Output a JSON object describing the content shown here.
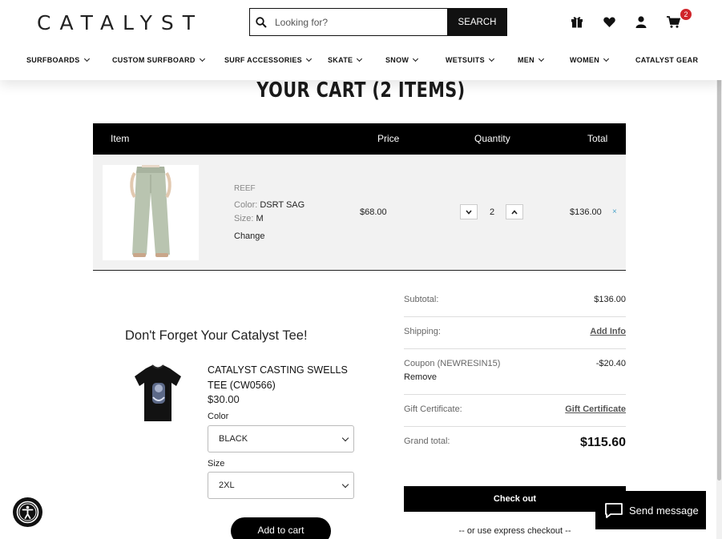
{
  "header": {
    "logo": "CATALYST",
    "search": {
      "placeholder": "Looking for?",
      "button_label": "SEARCH"
    },
    "icons": [
      "gift-icon",
      "heart-icon",
      "user-icon",
      "cart-icon"
    ],
    "cart_count": "2"
  },
  "nav": {
    "items": [
      {
        "label": "SURFBOARDS",
        "has_dropdown": true
      },
      {
        "label": "CUSTOM SURFBOARD",
        "has_dropdown": true
      },
      {
        "label": "SURF ACCESSORIES",
        "has_dropdown": true
      },
      {
        "label": "SKATE",
        "has_dropdown": true
      },
      {
        "label": "SNOW",
        "has_dropdown": true
      },
      {
        "label": "WETSUITS",
        "has_dropdown": true
      },
      {
        "label": "MEN",
        "has_dropdown": true
      },
      {
        "label": "WOMEN",
        "has_dropdown": true
      },
      {
        "label": "CATALYST GEAR",
        "has_dropdown": false
      }
    ]
  },
  "cart": {
    "title": "YOUR CART (2 ITEMS)",
    "columns": {
      "item": "Item",
      "price": "Price",
      "quantity": "Quantity",
      "total": "Total"
    },
    "items": [
      {
        "brand": "REEF",
        "color_label": "Color:",
        "color": "DSRT SAG",
        "size_label": "Size:",
        "size": "M",
        "change_label": "Change",
        "price": "$68.00",
        "quantity": "2",
        "total": "$136.00",
        "remove": "×"
      }
    ]
  },
  "upsell": {
    "title": "Don't Forget Your Catalyst Tee!",
    "product_name": "CATALYST CASTING SWELLS TEE (CW0566)",
    "price": "$30.00",
    "color_label": "Color",
    "color_value": "BLACK",
    "size_label": "Size",
    "size_value": "2XL",
    "add_button": "Add to cart"
  },
  "summary": {
    "subtotal_label": "Subtotal:",
    "subtotal": "$136.00",
    "shipping_label": "Shipping:",
    "shipping_link": "Add Info",
    "coupon_label": "Coupon (NEWRESIN15)",
    "coupon_remove": "Remove",
    "coupon_value": "-$20.40",
    "gift_label": "Gift Certificate:",
    "gift_link": "Gift Certificate",
    "grand_label": "Grand total:",
    "grand_total": "$115.60",
    "checkout_button": "Check out",
    "express_text": "-- or use express checkout --"
  },
  "widgets": {
    "send_message": "Send message"
  },
  "colors": {
    "primary": "#000000",
    "badge": "#d0252b",
    "remove_x": "#4aa3c9"
  }
}
